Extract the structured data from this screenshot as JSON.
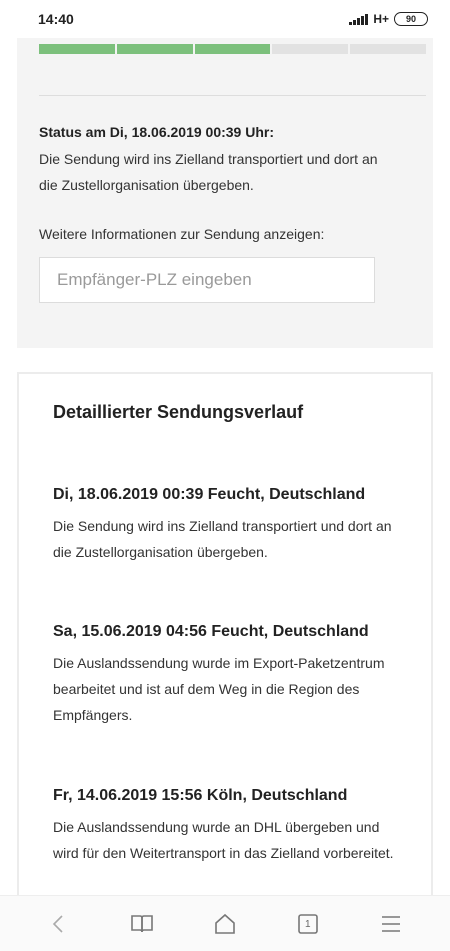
{
  "statusbar": {
    "time": "14:40",
    "network": "H+",
    "battery": "90"
  },
  "progress": {
    "segments": 5,
    "completed": 3
  },
  "status": {
    "heading": "Status am Di, 18.06.2019 00:39 Uhr:",
    "text": "Die Sendung wird ins Zielland transportiert und dort an die Zustellorganisation übergeben.",
    "info_label": "Weitere Informationen zur Sendung anzeigen:",
    "plz_placeholder": "Empfänger-PLZ eingeben"
  },
  "history": {
    "title": "Detaillierter Sendungsverlauf",
    "events": [
      {
        "head": "Di, 18.06.2019 00:39 Feucht, Deutschland",
        "desc": "Die Sendung wird ins Zielland transportiert und dort an die Zustellorganisation übergeben."
      },
      {
        "head": "Sa, 15.06.2019 04:56 Feucht, Deutschland",
        "desc": "Die Auslandssendung wurde im Export-Paketzentrum bearbeitet und ist auf dem Weg in die Region des Empfängers."
      },
      {
        "head": "Fr, 14.06.2019 15:56 Köln, Deutschland",
        "desc": "Die Auslandssendung wurde an DHL übergeben und wird für den Weitertransport in das Zielland vorbereitet."
      }
    ]
  },
  "navbar": {
    "icons": [
      "back-icon",
      "bookmarks-icon",
      "home-icon",
      "tabs-icon",
      "menu-icon"
    ],
    "tab_count": "1"
  }
}
